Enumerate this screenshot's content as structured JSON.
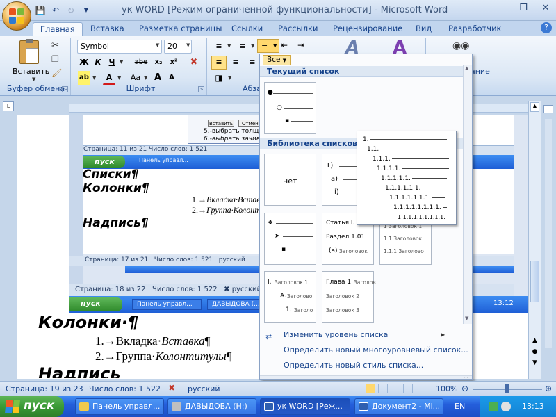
{
  "window": {
    "title": "ук WORD [Режим ограниченной функциональности] - Microsoft Word"
  },
  "quick_access": {
    "icons": [
      "save-icon",
      "undo-icon",
      "redo-icon",
      "dropdown-icon"
    ]
  },
  "ribbon": {
    "tabs": [
      "Главная",
      "Вставка",
      "Разметка страницы",
      "Ссылки",
      "Рассылки",
      "Рецензирование",
      "Вид",
      "Разработчик"
    ],
    "active_tab": "Главная",
    "clipboard": {
      "paste_label": "Вставить",
      "group_label": "Буфер обмена"
    },
    "font": {
      "name": "Symbol",
      "size": "20",
      "bold": "Ж",
      "italic": "К",
      "underline": "Ч",
      "strike": "abe",
      "subscript": "x₂",
      "superscript": "x²",
      "case": "Aa",
      "grow": "A",
      "shrink": "A",
      "group_label": "Шрифт"
    },
    "paragraph": {
      "group_label": "Абзац"
    },
    "editing": {
      "partial_label": "ание"
    }
  },
  "document": {
    "nested": {
      "dialog_buttons": [
        "Вставить",
        "Отмена"
      ],
      "dialog_items": [
        "5.-выбрать толщин",
        "6.-выбрать зачиван"
      ],
      "status1": "Страница: 11 из 21   Число слов: 1 521",
      "start": "пуск",
      "task1": "Панель управл...",
      "heading1": "Списки¶",
      "heading2": "Колонки¶",
      "item1_num": "1.",
      "item1_text": "Вкладка·Вставка",
      "item2_num": "2.",
      "item2_text": "Группа·Колонтит",
      "heading3": "Надпись¶",
      "status2_page": "Страница: 17 из 21",
      "status2_words": "Число слов: 1 521",
      "status2_lang": "русский",
      "status3_page": "Страница: 18 из 22",
      "status3_words": "Число слов: 1 522",
      "status3_lang": "русский",
      "taskbar2": [
        "Панель управл...",
        "ДАВЫДОВА (..."
      ],
      "clock": "13:12"
    },
    "heading": "Колонки·¶",
    "items": [
      {
        "num": "1.",
        "text": "Вкладка·",
        "em": "Вставка",
        "end": "¶"
      },
      {
        "num": "2.",
        "text": "Группа·",
        "em": "Колонтитулы",
        "end": "¶"
      }
    ],
    "cut_heading": "Надпись"
  },
  "list_menu": {
    "filter": "Все",
    "current_section": "Текущий список",
    "library_section": "Библиотека списков",
    "none_label": "нет",
    "numbered_labels": [
      "1)",
      "a)",
      "i)"
    ],
    "article_tile": {
      "line1": "Статья I.",
      "line2": "Раздел 1.01",
      "line3": "(a)",
      "line3_sub": "Заголовок"
    },
    "heading_tile_a": {
      "line1": "1 Заголовок 1",
      "line2": "1.1 Заголовок",
      "line3": "1.1.1 Заголово"
    },
    "heading_tile_b": {
      "line1": "I.",
      "line1_sub": "Заголовок 1",
      "line2": "A.",
      "line2_sub": "Заголово",
      "line3": "1.",
      "line3_sub": "Заголо"
    },
    "heading_tile_c": {
      "line1": "Глава 1",
      "line1_sub": "Заголов",
      "line2": "Заголовок 2",
      "line3": "Заголовок 3"
    },
    "commands": [
      "Изменить уровень списка",
      "Определить новый многоуровневый список...",
      "Определить новый стиль списка..."
    ],
    "preview_levels": [
      "1.",
      "1.1.",
      "1.1.1.",
      "1.1.1.1.",
      "1.1.1.1.1.",
      "1.1.1.1.1.1.",
      "1.1.1.1.1.1.1.",
      "1.1.1.1.1.1.1.1.",
      "1.1.1.1.1.1.1.1.1."
    ]
  },
  "statusbar": {
    "page": "Страница: 19 из 23",
    "words": "Число слов: 1 522",
    "lang": "русский",
    "zoom": "100%"
  },
  "taskbar": {
    "start": "пуск",
    "items": [
      "Панель управл...",
      "ДАВЫДОВА (H:)",
      "ук WORD [Реж...",
      "Документ2 - Mi..."
    ],
    "lang": "EN",
    "clock": "13:13"
  },
  "colors": {
    "accent": "#15428b",
    "highlight": "#ffe38a",
    "taskbar": "#245edb"
  }
}
